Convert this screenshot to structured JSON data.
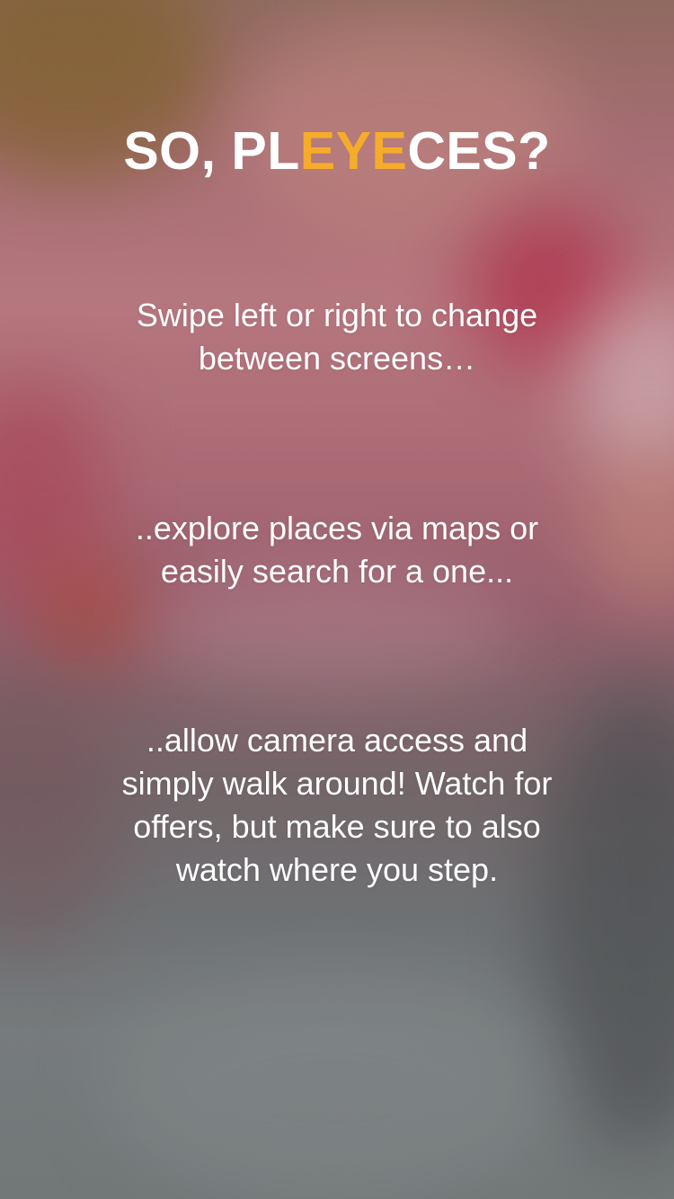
{
  "onboarding": {
    "headline": {
      "prefix": "SO, PL",
      "accent": "EYE",
      "suffix": "CES?"
    },
    "accent_color": "#f5ac2b",
    "steps": [
      "Swipe left or right to change between screens…",
      "..explore places via maps or easily search for a one...",
      "..allow camera access and simply walk around! Watch for offers, but make sure to also watch where you step."
    ]
  }
}
